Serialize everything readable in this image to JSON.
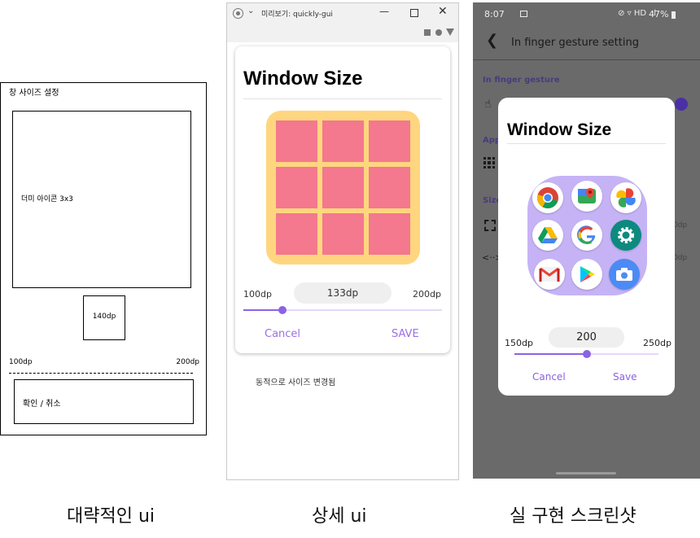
{
  "wireframe": {
    "title": "창 사이즈  설정",
    "icons_label": "더미 아이콘 3x3",
    "size_label": "140dp",
    "min_label": "100dp",
    "max_label": "200dp",
    "buttons_label": "확인 / 취소"
  },
  "detail": {
    "window_title": "미리보기: quickly-gui",
    "dialog_title": "Window Size",
    "grid_cells": 9,
    "slider": {
      "min": "100dp",
      "value": "133dp",
      "max": "200dp",
      "fraction": 0.33
    },
    "cancel_label": "Cancel",
    "save_label": "SAVE",
    "note": "동적으로 사이즈 변경됨",
    "colors": {
      "grid_bg": "#ffd67f",
      "cell": "#f4788e",
      "accent": "#8c62e6"
    }
  },
  "phone": {
    "status": {
      "time": "8:07",
      "right_icons": "⊘ ▿ HD .ıl",
      "battery": "47%"
    },
    "appbar_title": "In finger gesture setting",
    "section_1": "In finger gesture",
    "section_2": "App",
    "section_3": "Size",
    "row_value_1": "0dp",
    "row_value_2": "0dp",
    "dialog": {
      "title": "Window Size",
      "icons": [
        "chrome-icon",
        "maps-icon",
        "photos-icon",
        "drive-icon",
        "google-icon",
        "settings-icon",
        "gmail-icon",
        "play-store-icon",
        "camera-icon"
      ],
      "slider": {
        "min": "150dp",
        "value": "200",
        "max": "250dp",
        "fraction": 0.5
      },
      "cancel_label": "Cancel",
      "save_label": "Save"
    },
    "colors": {
      "dialog_bg": "#ffffff",
      "squircle": "#c6b3f6",
      "accent": "#8a5fe0"
    }
  },
  "captions": [
    "대략적인 ui",
    "상세 ui",
    "실 구현 스크린샷"
  ]
}
